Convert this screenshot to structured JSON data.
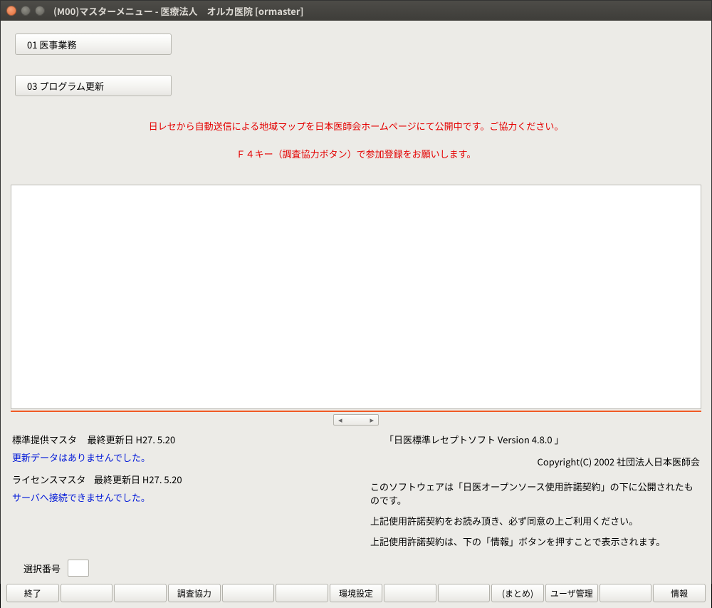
{
  "window": {
    "title": "(M00)マスターメニュー - 医療法人　オルカ医院  [ormaster]"
  },
  "menu": {
    "items": [
      {
        "label": "01  医事業務"
      },
      {
        "label": "03  プログラム更新"
      }
    ]
  },
  "notices": [
    "日レセから自動送信による地域マップを日本医師会ホームページにて公開中です。ご協力ください。",
    "Ｆ４キー（調査協力ボタン）で参加登録をお願いします。"
  ],
  "info_left": {
    "std_master_label": "標準提供マスタ",
    "std_master_update": "最終更新日 H27. 5.20",
    "std_master_msg": "更新データはありませんでした。",
    "lic_master_label": "ライセンスマスタ",
    "lic_master_update": "最終更新日 H27. 5.20",
    "lic_master_msg": "サーバへ接続できませんでした。"
  },
  "info_right": {
    "version": "「日医標準レセプトソフト  Version  4.8.0 」",
    "copyright": "Copyright(C) 2002 社団法人日本医師会",
    "note1": "このソフトウェアは「日医オープンソース使用許諾契約」の下に公開されたものです。",
    "note2": "上記使用許諾契約をお読み頂き、必ず同意の上ご利用ください。",
    "note3": "上記使用許諾契約は、下の「情報」ボタンを押すことで表示されます。"
  },
  "select": {
    "label": "選択番号",
    "value": ""
  },
  "fkeys": [
    "終了",
    "",
    "",
    "調査協力",
    "",
    "",
    "環境設定",
    "",
    "",
    "(まとめ)",
    "ユーザ管理",
    "",
    "情報"
  ]
}
